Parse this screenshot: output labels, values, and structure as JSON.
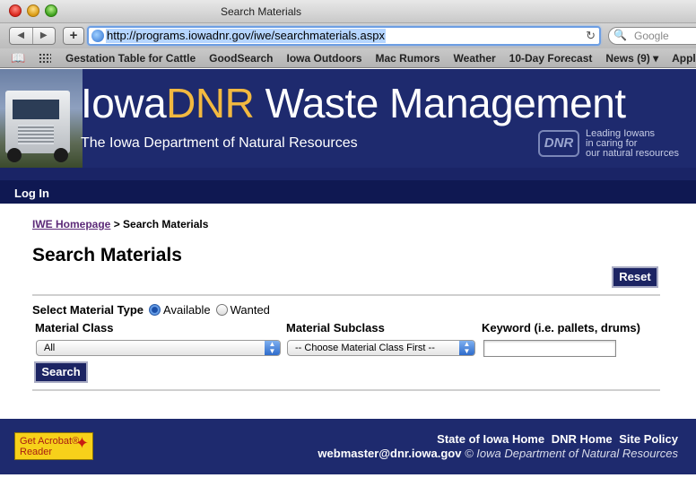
{
  "window": {
    "title": "Search Materials"
  },
  "toolbar": {
    "back_label": "◀",
    "forward_label": "▶",
    "add_label": "+",
    "url": "http://programs.iowadnr.gov/iwe/searchmaterials.aspx",
    "reload_label": "↻",
    "search_placeholder": "Google",
    "search_icon_label": "🔍"
  },
  "bookmarks": {
    "items": [
      "Gestation Table for Cattle",
      "GoodSearch",
      "Iowa Outdoors",
      "Mac Rumors",
      "Weather",
      "10-Day Forecast",
      "News (9) ▾",
      "Apple"
    ]
  },
  "banner": {
    "title_a": "Iowa",
    "title_b": "DNR",
    "title_c": " Waste Management",
    "subtitle": "The Iowa Department of Natural Resources",
    "logo_text": "DNR",
    "tag_line1": "Leading Iowans",
    "tag_line2": "in caring for",
    "tag_line3": "our natural resources"
  },
  "nav": {
    "login": "Log In"
  },
  "breadcrumb": {
    "home": "IWE Homepage",
    "separator": " > ",
    "current": "Search Materials"
  },
  "page": {
    "title": "Search Materials",
    "reset_label": "Reset",
    "search_label": "Search"
  },
  "form": {
    "type_label": "Select Material Type",
    "available_label": "Available",
    "wanted_label": "Wanted",
    "selected_type": "Available",
    "class_label": "Material Class",
    "class_value": "All",
    "subclass_label": "Material Subclass",
    "subclass_value": "-- Choose Material Class First --",
    "keyword_label": "Keyword (i.e. pallets, drums)",
    "keyword_value": ""
  },
  "footer": {
    "acrobat_line1": "Get Acrobat®",
    "acrobat_line2": "Reader",
    "link_state": "State of Iowa Home",
    "link_dnr": "DNR Home",
    "link_policy": "Site Policy",
    "email": "webmaster@dnr.iowa.gov",
    "copyright": "© Iowa Department of Natural Resources"
  },
  "colors": {
    "banner_navy": "#1e2a6e",
    "dnr_gold": "#f2b940",
    "link_purple": "#5c2a78"
  }
}
